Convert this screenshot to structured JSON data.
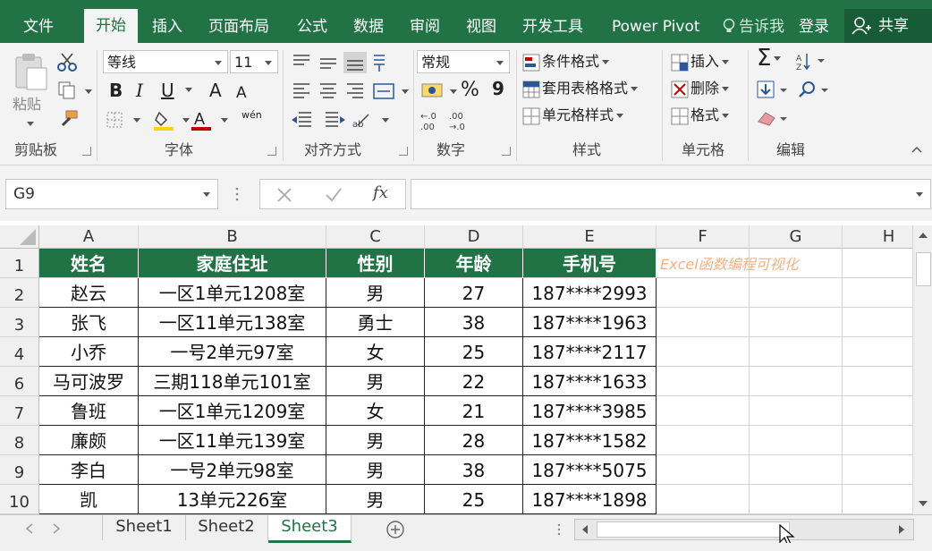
{
  "ribbon_tabs": [
    "文件",
    "开始",
    "插入",
    "页面布局",
    "公式",
    "数据",
    "审阅",
    "视图",
    "开发工具",
    "Power Pivot"
  ],
  "active_tab": "开始",
  "tell_me": "告诉我",
  "login": "登录",
  "share": "共享",
  "groups": {
    "clipboard": {
      "label": "剪贴板",
      "paste": "粘贴"
    },
    "font": {
      "label": "字体",
      "font_name": "等线",
      "font_size": "11",
      "bold": "B",
      "italic": "I",
      "underline": "U",
      "grow": "A",
      "shrink": "A",
      "phonetic": "wén"
    },
    "alignment": {
      "label": "对齐方式"
    },
    "number": {
      "label": "数字",
      "format": "常规",
      "percent": "%",
      "comma": "9"
    },
    "styles": {
      "label": "样式",
      "conditional": "条件格式",
      "table_format": "套用表格格式",
      "cell_styles": "单元格样式"
    },
    "cells": {
      "label": "单元格",
      "insert": "插入",
      "delete": "删除",
      "format": "格式"
    },
    "editing": {
      "label": "编辑"
    }
  },
  "formula_bar": {
    "name_box": "G9",
    "fx": "fx",
    "formula": ""
  },
  "columns": [
    "A",
    "B",
    "C",
    "D",
    "E",
    "F",
    "G",
    "H"
  ],
  "row_numbers": [
    "1",
    "2",
    "3",
    "4",
    "6",
    "7",
    "8",
    "9",
    "10"
  ],
  "table": {
    "headers": [
      "姓名",
      "家庭住址",
      "性别",
      "年龄",
      "手机号"
    ],
    "rows": [
      [
        "赵云",
        "一区1单元1208室",
        "男",
        "27",
        "187****2993"
      ],
      [
        "张飞",
        "一区11单元138室",
        "勇士",
        "38",
        "187****1963"
      ],
      [
        "小乔",
        "一号2单元97室",
        "女",
        "25",
        "187****2117"
      ],
      [
        "马可波罗",
        "三期118单元101室",
        "男",
        "22",
        "187****1633"
      ],
      [
        "鲁班",
        "一区1单元1209室",
        "女",
        "21",
        "187****3985"
      ],
      [
        "廉颇",
        "一区11单元139室",
        "男",
        "28",
        "187****1582"
      ],
      [
        "李白",
        "一号2单元98室",
        "男",
        "38",
        "187****5075"
      ],
      [
        "凯",
        "13单元226室",
        "男",
        "25",
        "187****1898"
      ]
    ]
  },
  "watermark": "Excel函数编程可视化",
  "sheet_tabs": [
    "Sheet1",
    "Sheet2",
    "Sheet3"
  ],
  "active_sheet": "Sheet3",
  "colors": {
    "excel_green": "#217346",
    "dark_green": "#185c37",
    "watermark": "#f4b183"
  }
}
